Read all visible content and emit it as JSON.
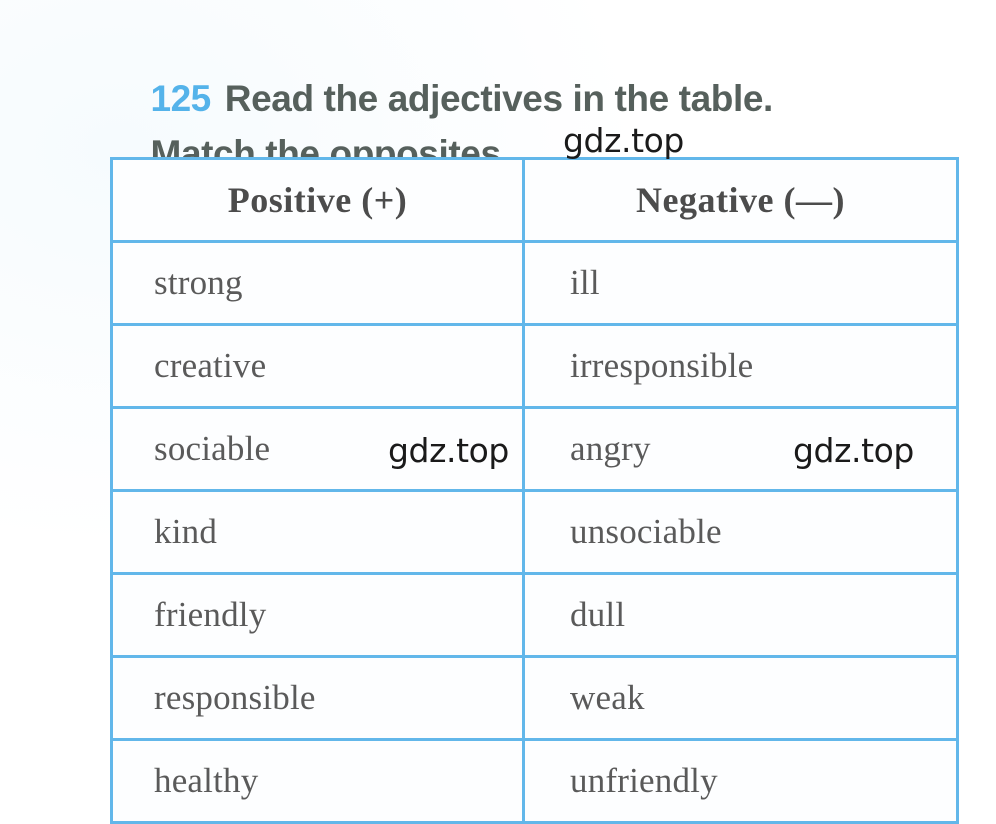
{
  "exercise": {
    "number": "125",
    "instruction_line1": "Read the adjectives in the table.",
    "instruction_line2": "Match the opposites.",
    "number_color": "#54b3ea",
    "text_color": "#56605c"
  },
  "table": {
    "border_color": "#62b7ea",
    "headers": {
      "positive": "Positive (+)",
      "negative": "Negative (—)"
    },
    "rows": [
      {
        "positive": "strong",
        "negative": "ill"
      },
      {
        "positive": "creative",
        "negative": "irresponsible"
      },
      {
        "positive": "sociable",
        "negative": "angry"
      },
      {
        "positive": "kind",
        "negative": "unsociable"
      },
      {
        "positive": "friendly",
        "negative": "dull"
      },
      {
        "positive": "responsible",
        "negative": "weak"
      },
      {
        "positive": "healthy",
        "negative": "unfriendly"
      }
    ]
  },
  "watermarks": {
    "top": "gdz.top",
    "middle_left": "gdz.top",
    "middle_right": "gdz.top"
  }
}
